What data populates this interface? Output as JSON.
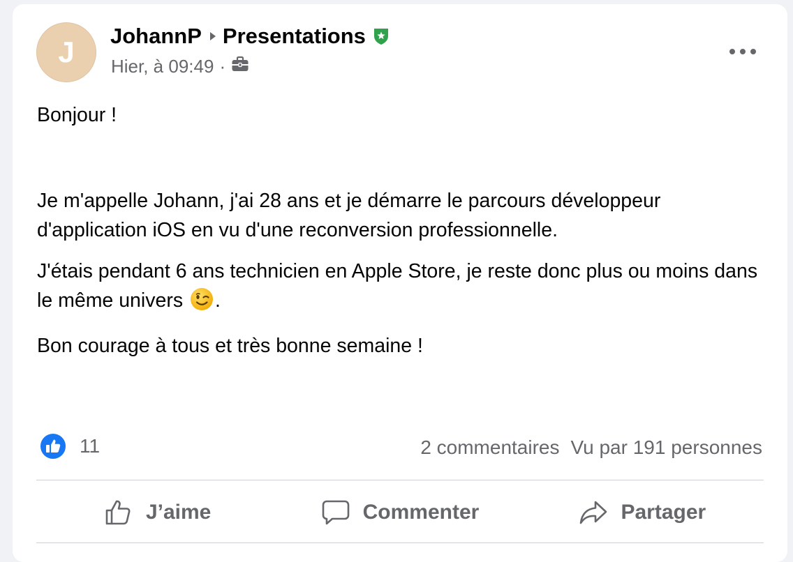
{
  "post": {
    "author": "JohannP",
    "group": "Presentations",
    "avatar_initial": "J",
    "timestamp": "Hier, à 09:49",
    "meta_separator": "·",
    "icons": {
      "separator": "caret-right-icon",
      "group_badge": "shield-star-icon",
      "audience": "briefcase-icon",
      "more": "more-horizontal-icon"
    },
    "paragraphs": {
      "p1": "Bonjour !",
      "p2": "Je m'appelle Johann, j'ai 28 ans et je démarre le parcours développeur d'application iOS en vu d'une reconversion professionnelle.",
      "p3": "J'étais pendant 6 ans technicien en Apple Store, je reste donc plus ou moins dans le même univers",
      "p3_end": ".",
      "p4": "Bon courage à tous et très bonne semaine !"
    },
    "emoji": "winking-face-icon"
  },
  "stats": {
    "likes": "11",
    "comments": "2 commentaires",
    "views": "Vu par 191 personnes"
  },
  "actions": {
    "like": "J’aime",
    "comment": "Commenter",
    "share": "Partager"
  },
  "colors": {
    "like_blue": "#1877f2",
    "badge_green": "#31a24c",
    "secondary_text": "#65676b",
    "avatar_bg": "#ebd0b0"
  }
}
